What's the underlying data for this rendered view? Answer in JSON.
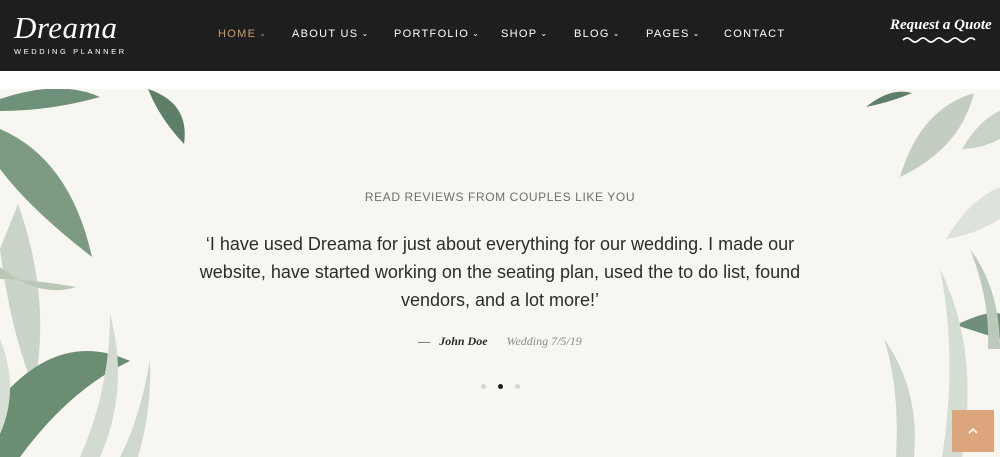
{
  "brand": {
    "name": "Dreama",
    "tagline": "WEDDING PLANNER"
  },
  "nav": {
    "items": [
      {
        "label": "HOME",
        "has_dropdown": true,
        "active": true
      },
      {
        "label": "ABOUT US",
        "has_dropdown": true,
        "active": false
      },
      {
        "label": "PORTFOLIO",
        "has_dropdown": true,
        "active": false
      },
      {
        "label": "SHOP",
        "has_dropdown": true,
        "active": false
      },
      {
        "label": "BLOG",
        "has_dropdown": true,
        "active": false
      },
      {
        "label": "PAGES",
        "has_dropdown": true,
        "active": false
      },
      {
        "label": "CONTACT",
        "has_dropdown": false,
        "active": false
      }
    ],
    "dropdown_icon": "chevron-down-icon",
    "cta_label": "Request a Quote"
  },
  "testimonial": {
    "eyebrow": "READ REVIEWS FROM COUPLES LIKE YOU",
    "quote": "‘I have used Dreama for just about everything for our wedding. I made our website, have started working on the seating plan, used the to do list, found vendors, and a lot more!’",
    "author_dash": "—",
    "author": "John Doe",
    "event": "Wedding 7/5/19",
    "slides_total": 3,
    "active_slide": 2
  },
  "scroll_top": {
    "icon": "chevron-up-icon"
  },
  "colors": {
    "header_bg": "#1e1e1e",
    "accent": "#c99b6b",
    "section_bg": "#f8f6f0",
    "scroll_button": "#dca57b"
  }
}
